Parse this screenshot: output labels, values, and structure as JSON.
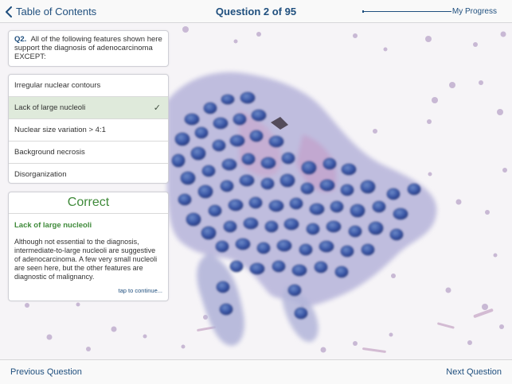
{
  "header": {
    "back_label": "Table of Contents",
    "title": "Question 2 of 95",
    "progress_label": "My Progress",
    "progress_fraction": 0.02
  },
  "question": {
    "number": "Q2.",
    "text": "All of the following features shown here support the diagnosis of adenocarcinoma EXCEPT:"
  },
  "answers": [
    {
      "label": "Irregular nuclear contours"
    },
    {
      "label": "Lack of large nucleoli",
      "selected": true
    },
    {
      "label": "Nuclear size variation > 4:1"
    },
    {
      "label": "Background necrosis"
    },
    {
      "label": "Disorganization"
    }
  ],
  "feedback": {
    "status": "Correct",
    "answer": "Lack of large nucleoli",
    "explanation": "Although not essential to the diagnosis, intermediate-to-large nucleoli are suggestive of adenocarcinoma. A few very small nucleoli are seen here, but the other features are diagnostic of malignancy.",
    "tap_label": "tap to continue..."
  },
  "footer": {
    "prev_label": "Previous Question",
    "next_label": "Next Question"
  },
  "colors": {
    "accent": "#1f4f7e",
    "correct": "#3f8a3a",
    "selected_bg": "#dfeadb",
    "nucleus": "#3a56a6",
    "cytoplasm": "#b7b5d8"
  }
}
